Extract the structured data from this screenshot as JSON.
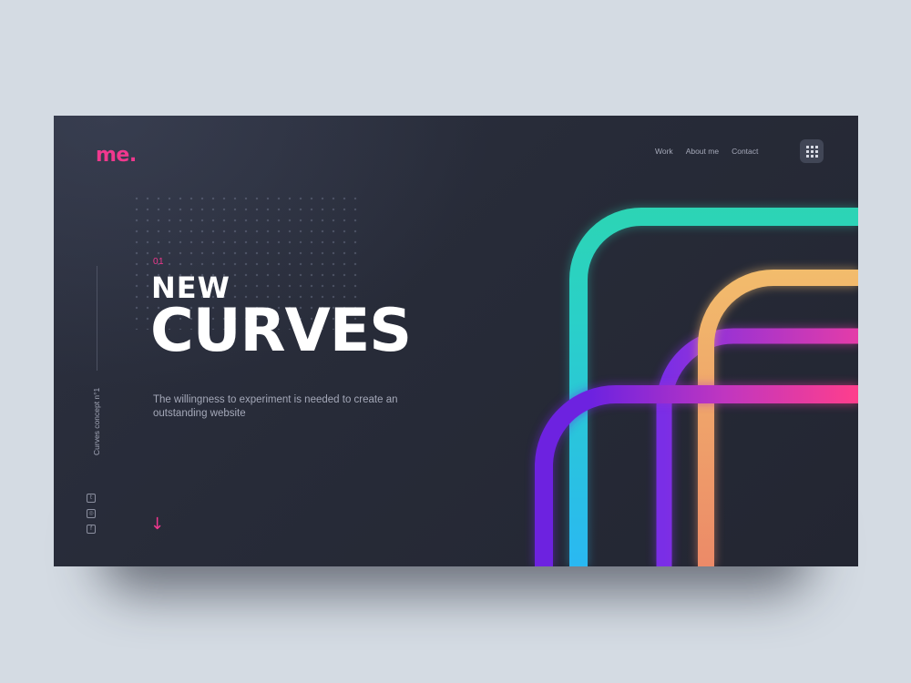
{
  "brand": {
    "logo": "me.",
    "accent": "#f0388e"
  },
  "nav": {
    "items": [
      {
        "label": "Work"
      },
      {
        "label": "About me"
      },
      {
        "label": "Contact"
      }
    ],
    "menu_icon": "grid-icon"
  },
  "sidebar": {
    "concept_label": "Curves concept n°1",
    "social": [
      {
        "icon": "twitter-icon",
        "glyph": "t"
      },
      {
        "icon": "instagram-icon",
        "glyph": "◎"
      },
      {
        "icon": "facebook-icon",
        "glyph": "f"
      }
    ]
  },
  "hero": {
    "number": "01",
    "title_small": "NEW",
    "title_large": "CURVES",
    "tagline": "The willingness to experiment is needed to create an outstanding website",
    "scroll_icon": "arrow-down-icon",
    "scroll_glyph": "↓"
  },
  "colors": {
    "background": "#d4dbe3",
    "card": "#272b38",
    "curve_teal": "#2fd8a4",
    "curve_blue": "#2ab8f2",
    "curve_orange": "#f0b868",
    "curve_pink": "#ff3e8c",
    "curve_purple": "#7a2ee6"
  }
}
